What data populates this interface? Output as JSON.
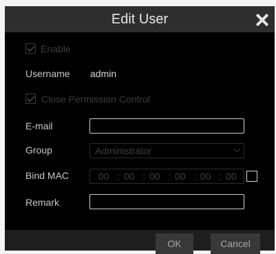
{
  "dialog": {
    "title": "Edit User",
    "close_icon": "close-icon"
  },
  "enable": {
    "label": "Enable",
    "checked": true,
    "disabled": true
  },
  "username": {
    "label": "Username",
    "value": "admin"
  },
  "close_permission": {
    "label": "Close Permission Control",
    "checked": true,
    "disabled": true
  },
  "email": {
    "label": "E-mail",
    "value": ""
  },
  "group": {
    "label": "Group",
    "selected": "Administrator"
  },
  "bind_mac": {
    "label": "Bind MAC",
    "octets": [
      "00",
      "00",
      "00",
      "00",
      "00",
      "00"
    ],
    "separator": ":",
    "checked": false
  },
  "remark": {
    "label": "Remark",
    "value": ""
  },
  "buttons": {
    "ok": "OK",
    "cancel": "Cancel"
  },
  "colors": {
    "dialog_bg": "#000000",
    "titlebar_bg": "#2e2e2e",
    "button_bg": "#383838",
    "disabled_text": "#3c3c3c"
  }
}
